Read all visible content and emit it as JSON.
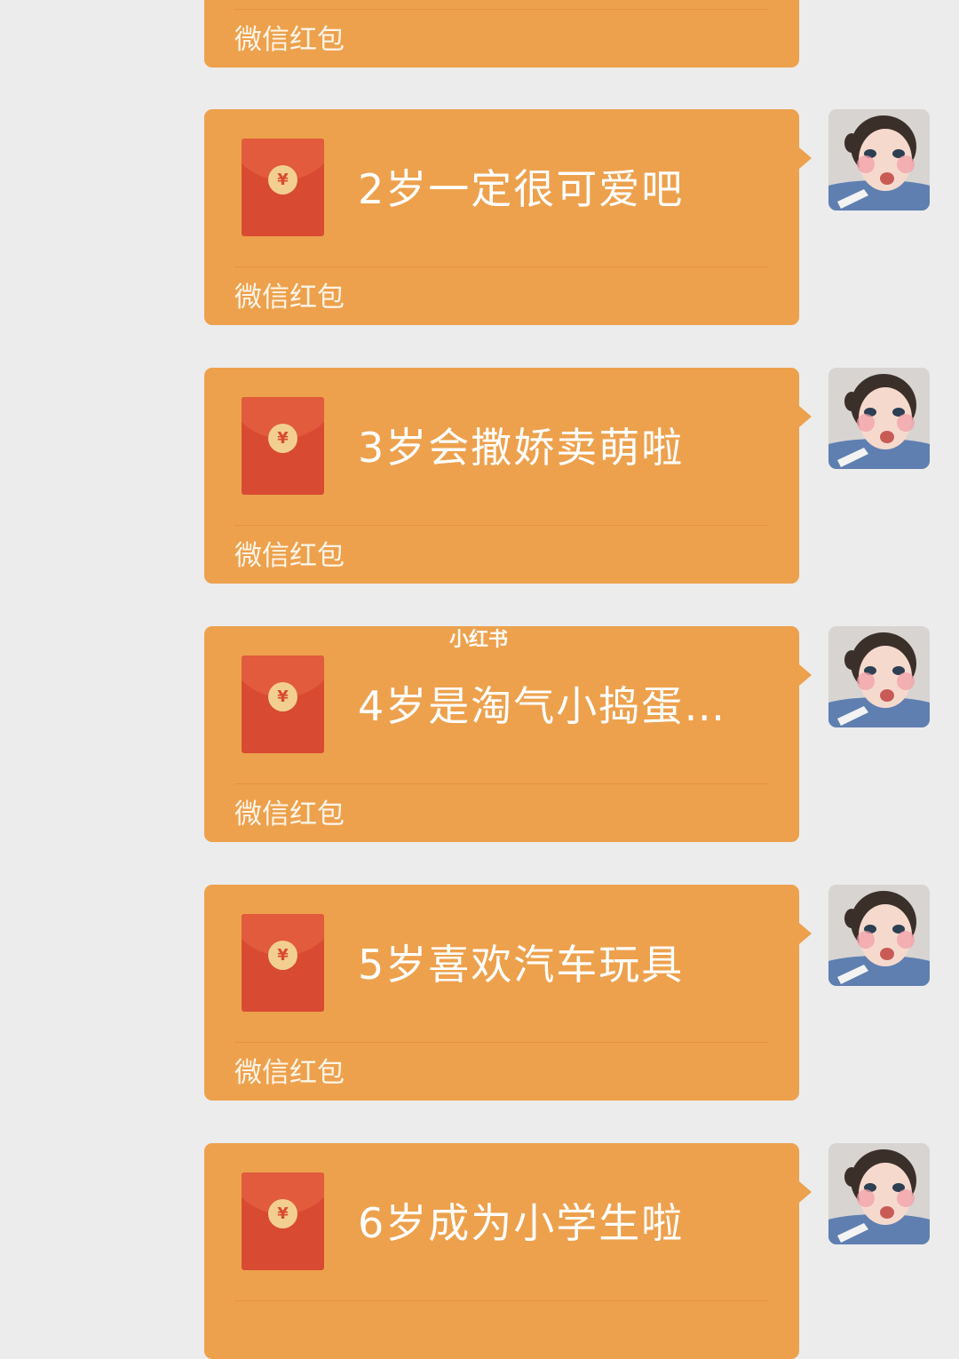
{
  "top_partial_message": {
    "footer": "微信红包"
  },
  "messages": [
    {
      "greeting": "2岁一定很可爱吧",
      "footer": "微信红包",
      "coin": "¥"
    },
    {
      "greeting": "3岁会撒娇卖萌啦",
      "footer": "微信红包",
      "coin": "¥"
    },
    {
      "greeting": "4岁是淘气小捣蛋…",
      "footer": "微信红包",
      "coin": "¥"
    },
    {
      "greeting": "5岁喜欢汽车玩具",
      "footer": "微信红包",
      "coin": "¥"
    },
    {
      "greeting": "6岁成为小学生啦",
      "footer": "",
      "coin": "¥"
    }
  ],
  "watermark": "小红书",
  "colors": {
    "background": "#ececec",
    "bubble": "#eda14d",
    "envelope": "#d94a33",
    "envelope_flap": "#e15b3c",
    "coin": "#f2cf91"
  },
  "icons": {
    "envelope": "red-envelope-icon",
    "avatar": "baby-avatar-icon"
  }
}
